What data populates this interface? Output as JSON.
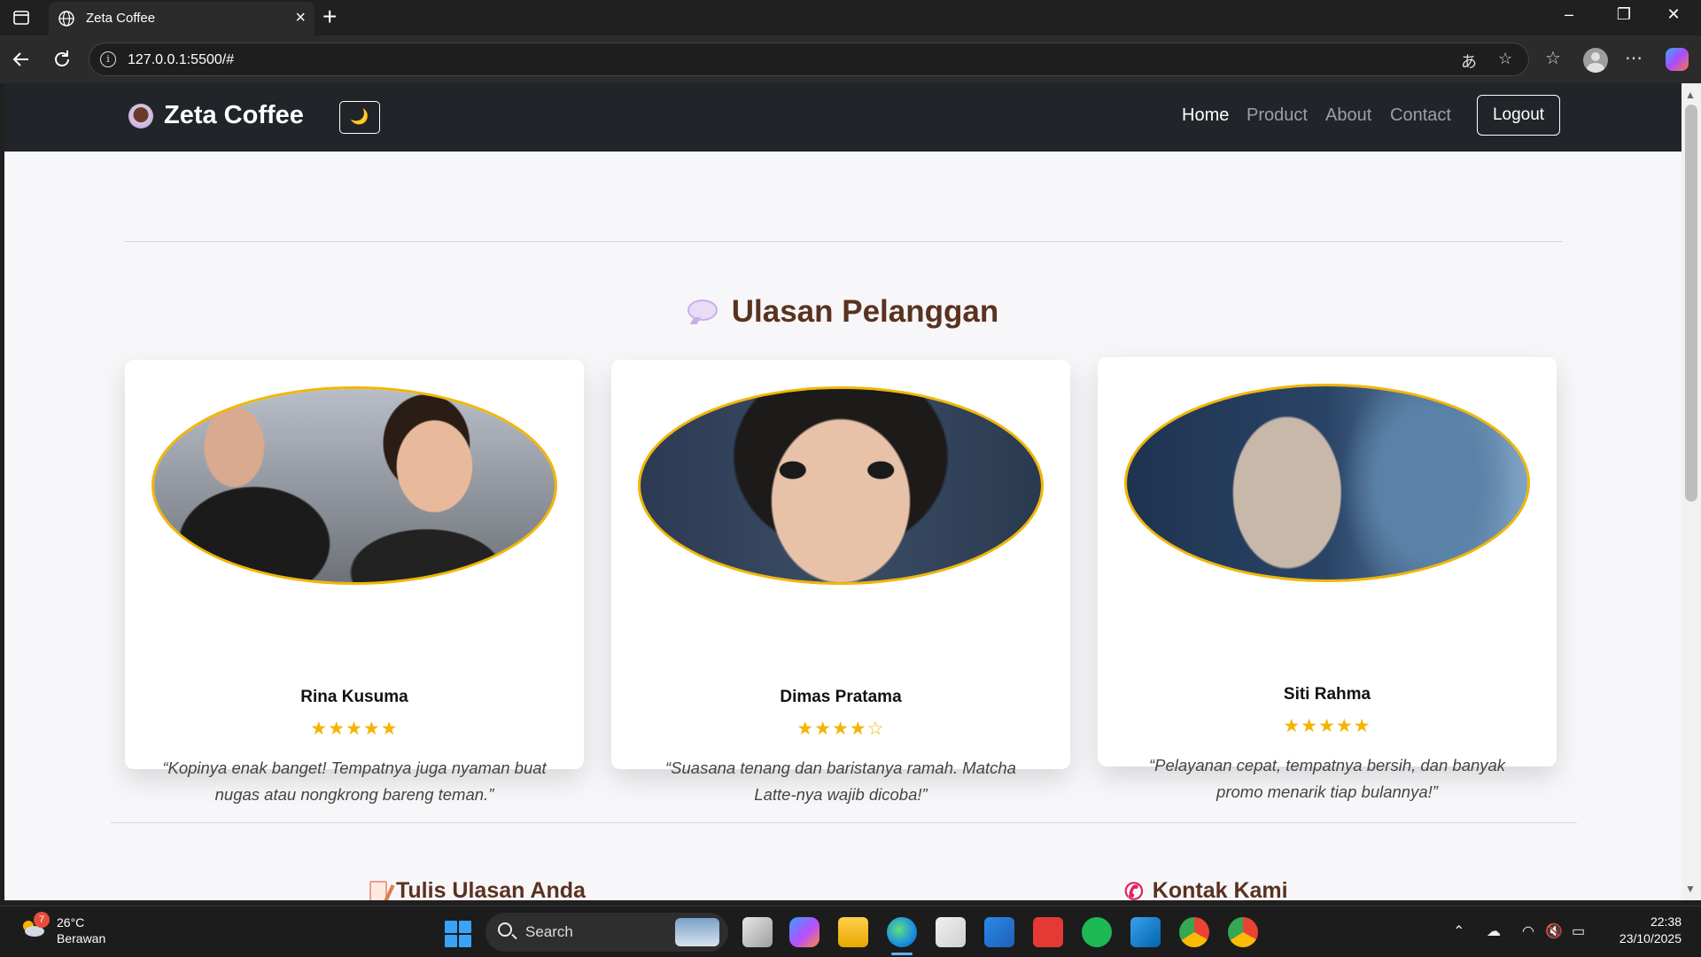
{
  "browser": {
    "tab_title": "Zeta Coffee",
    "url": "127.0.0.1:5500/#"
  },
  "navbar": {
    "brand": "Zeta Coffee",
    "theme_toggle": "🌙",
    "menu": [
      "Home",
      "Product",
      "About",
      "Contact"
    ],
    "active": "Home",
    "logout": "Logout"
  },
  "reviews": {
    "title": "Ulasan Pelanggan",
    "cards": [
      {
        "name": "Rina Kusuma",
        "stars": "★★★★★",
        "quote": "“Kopinya enak banget! Tempatnya juga nyaman buat nugas atau nongkrong bareng teman.”"
      },
      {
        "name": "Dimas Pratama",
        "stars": "★★★★☆",
        "quote": "“Suasana tenang dan baristanya ramah. Matcha Latte-nya wajib dicoba!”"
      },
      {
        "name": "Siti Rahma",
        "stars": "★★★★★",
        "quote": "“Pelayanan cepat, tempatnya bersih, dan banyak promo menarik tiap bulannya!”"
      }
    ]
  },
  "sections": {
    "write_review": "Tulis Ulasan Anda",
    "contact": "Kontak Kami"
  },
  "taskbar": {
    "weather_badge": "7",
    "temperature": "26°C",
    "condition": "Berawan",
    "search": "Search",
    "time": "22:38",
    "date": "23/10/2025"
  },
  "colors": {
    "navbar_bg": "#212529",
    "heading_brown": "#5a3220",
    "star_gold": "#f4b400",
    "avatar_border": "#f2b600"
  }
}
